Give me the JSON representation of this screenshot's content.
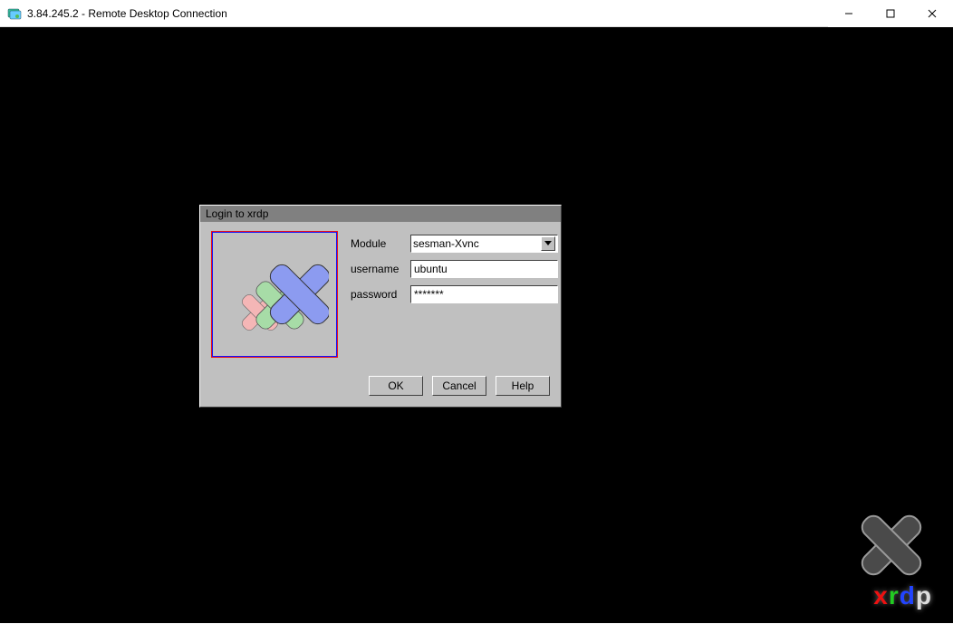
{
  "window": {
    "title": "3.84.245.2 - Remote Desktop Connection"
  },
  "dialog": {
    "title": "Login to xrdp",
    "modules_label": "Module",
    "module_selected": "sesman-Xvnc",
    "username_label": "username",
    "username_value": "ubuntu",
    "password_label": "password",
    "password_value": "*******",
    "ok": "OK",
    "cancel": "Cancel",
    "help": "Help"
  },
  "watermark": {
    "text": "xrdp"
  }
}
